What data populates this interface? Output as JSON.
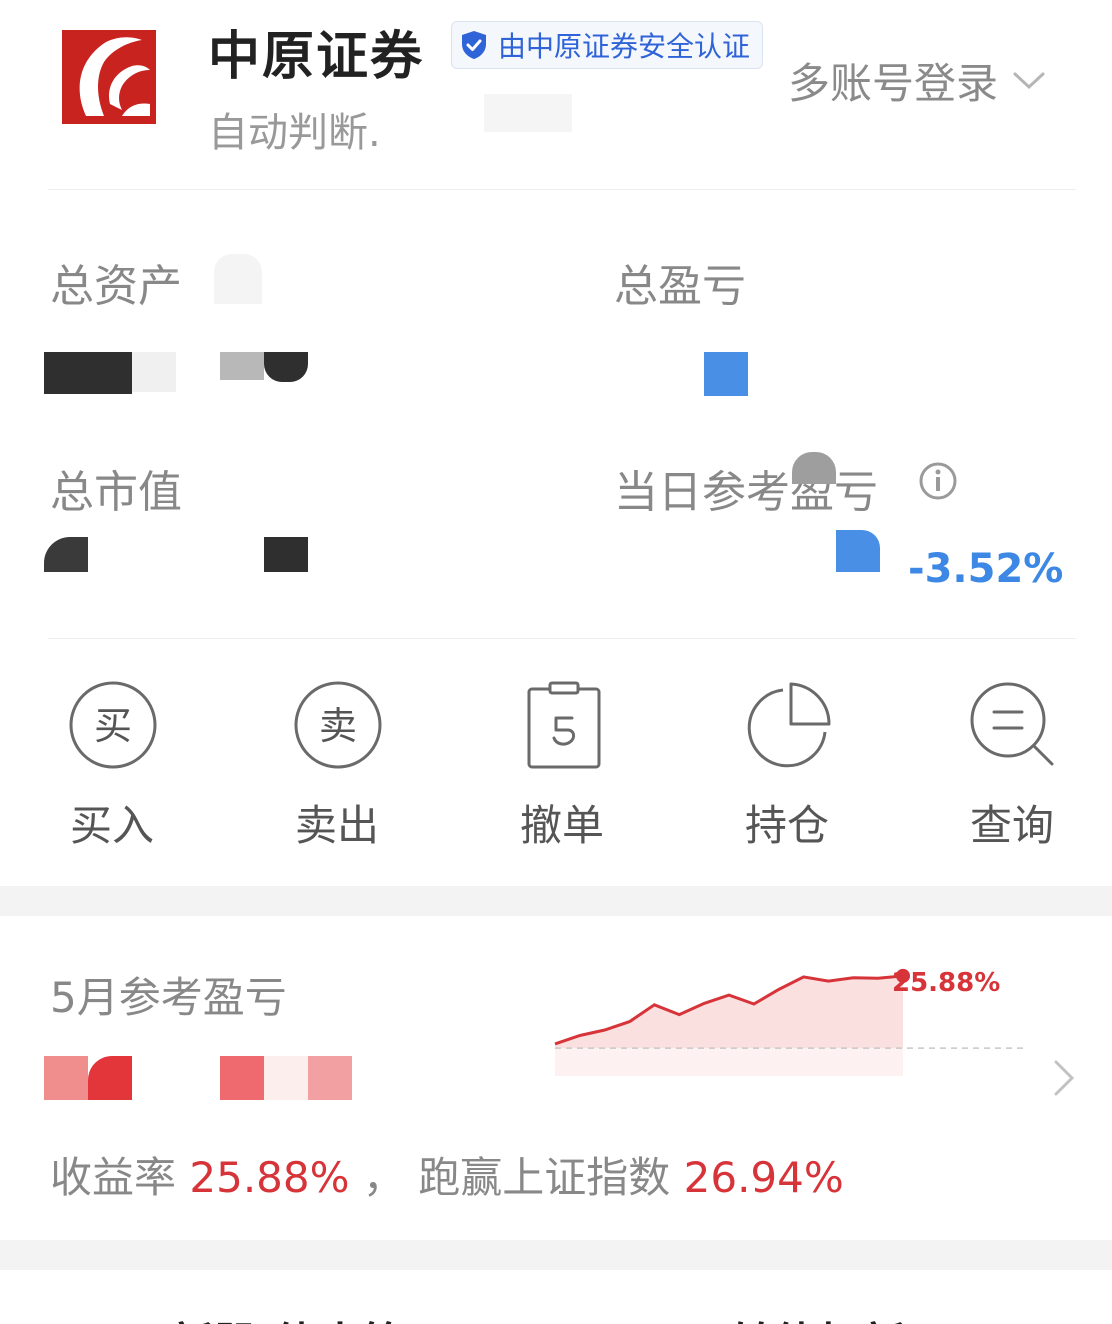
{
  "header": {
    "broker_name": "中原证券",
    "verify_text": "由中原证券安全认证",
    "account_login": "多账号登录",
    "mode": "自动判断",
    "colors": {
      "brand_red": "#c8231f",
      "verify_blue": "#2f63d8"
    }
  },
  "assets": {
    "total_assets_label": "总资产",
    "total_pnl_label": "总盈亏",
    "market_value_label": "总市值",
    "daily_pnl_label": "当日参考盈亏",
    "daily_pnl_pct": "-3.52%"
  },
  "actions": [
    {
      "label": "买入",
      "icon": "buy-icon",
      "glyph": "买"
    },
    {
      "label": "卖出",
      "icon": "sell-icon",
      "glyph": "卖"
    },
    {
      "label": "撤单",
      "icon": "cancel-order-icon"
    },
    {
      "label": "持仓",
      "icon": "pie-chart-icon"
    },
    {
      "label": "查询",
      "icon": "search-icon"
    }
  ],
  "monthly": {
    "title": "5月参考盈亏",
    "rate_label": "收益率",
    "rate_value": "25.88%",
    "sep": "，",
    "beat_label": "跑赢上证指数",
    "beat_value": "26.94%",
    "spark_end_label": "25.88%"
  },
  "bottom": {
    "tab1": "新股/债中签",
    "tab2": "可转债打新"
  },
  "chart_data": {
    "type": "area",
    "x": [
      1,
      2,
      3,
      4,
      5,
      6,
      7,
      8,
      9,
      10,
      11,
      12,
      13,
      14,
      15
    ],
    "values": [
      1.5,
      4.5,
      6.5,
      9.5,
      15.5,
      12.0,
      16.0,
      19.0,
      15.8,
      21.0,
      25.5,
      24.0,
      25.2,
      25.0,
      25.88
    ],
    "baseline": 0,
    "ylim": [
      -10,
      33
    ],
    "grid": false,
    "colors": {
      "line": "#d7343a",
      "fill": "#fbe0e0"
    }
  }
}
